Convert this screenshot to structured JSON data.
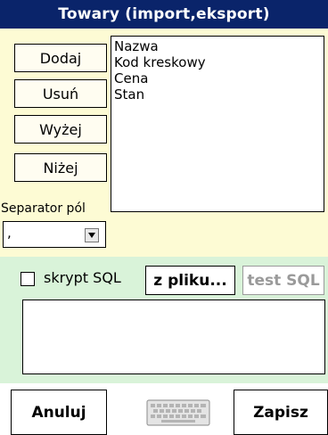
{
  "window": {
    "title": "Towary (import,eksport)"
  },
  "buttons": {
    "add": "Dodaj",
    "remove": "Usuń",
    "up": "Wyżej",
    "down": "Niżej"
  },
  "fields": [
    "Nazwa",
    "Kod kreskowy",
    "Cena",
    "Stan"
  ],
  "separator": {
    "label": "Separator pól",
    "value": ","
  },
  "sql": {
    "checkbox_label": "skrypt SQL",
    "checked": false,
    "from_file": "z pliku...",
    "test": "test SQL",
    "script": ""
  },
  "footer": {
    "cancel": "Anuluj",
    "save": "Zapisz",
    "keyboard_icon": "keyboard-icon"
  },
  "colors": {
    "titlebar": "#0a246a",
    "upper_panel": "#fdfbd4",
    "lower_panel": "#d9f3d9",
    "disabled_text": "#9a9a9a"
  }
}
